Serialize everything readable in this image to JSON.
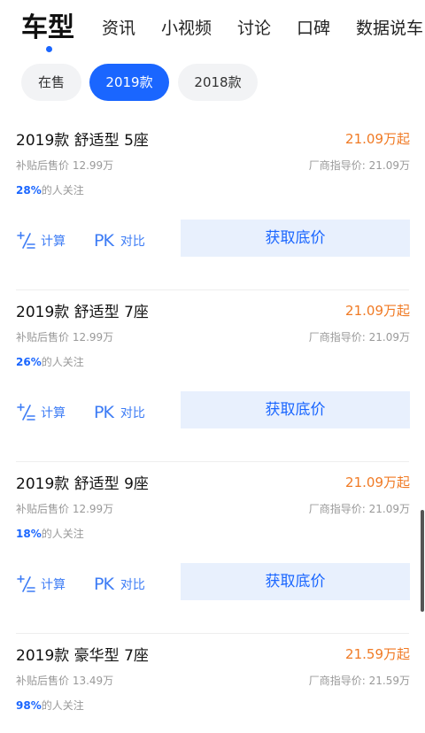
{
  "nav": {
    "tabs": [
      "车型",
      "资讯",
      "小视频",
      "讨论",
      "口碑",
      "数据说车"
    ]
  },
  "filters": [
    "在售",
    "2019款",
    "2018款"
  ],
  "actions": {
    "calc_label": "计算",
    "pk_icon_text": "PK",
    "pk_label": "对比",
    "get_price_label": "获取底价"
  },
  "cars": [
    {
      "title": "2019款 舒适型 5座",
      "price": "21.09万起",
      "subsidy": "补贴后售价  12.99万",
      "msrp": "厂商指导价: 21.09万",
      "attention_pct": "28%",
      "attention_suffix": "的人关注"
    },
    {
      "title": "2019款 舒适型 7座",
      "price": "21.09万起",
      "subsidy": "补贴后售价  12.99万",
      "msrp": "厂商指导价: 21.09万",
      "attention_pct": "26%",
      "attention_suffix": "的人关注"
    },
    {
      "title": "2019款 舒适型 9座",
      "price": "21.09万起",
      "subsidy": "补贴后售价  12.99万",
      "msrp": "厂商指导价: 21.09万",
      "attention_pct": "18%",
      "attention_suffix": "的人关注"
    },
    {
      "title": "2019款 豪华型 7座",
      "price": "21.59万起",
      "subsidy": "补贴后售价  13.49万",
      "msrp": "厂商指导价: 21.59万",
      "attention_pct": "98%",
      "attention_suffix": "的人关注"
    }
  ],
  "colors": {
    "accent": "#1a66ff",
    "price": "#f07a24",
    "get_price_bg": "#e8f0fd"
  }
}
